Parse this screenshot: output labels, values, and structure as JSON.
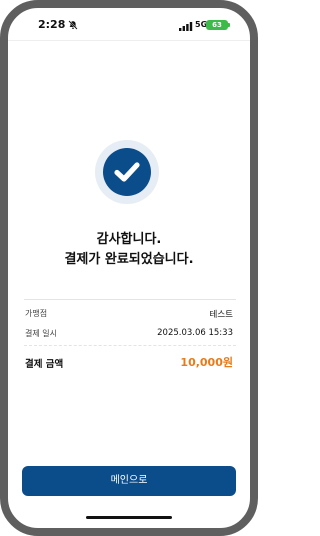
{
  "status_bar": {
    "time": "2:28",
    "network": "5G",
    "battery": "63"
  },
  "icons": {
    "mute": "bell-slash-icon",
    "signal": "signal-icon",
    "success": "check-circle-icon"
  },
  "colors": {
    "primary": "#0b4c8b",
    "accent": "#e87a17",
    "success_halo": "#e6edf4"
  },
  "message": {
    "line1": "감사합니다.",
    "line2": "결제가 완료되었습니다."
  },
  "details": {
    "rows": [
      {
        "label": "가맹점",
        "value": "테스트"
      },
      {
        "label": "결제 일시",
        "value": "2025.03.06 15:33"
      }
    ],
    "total_label": "결제 금액",
    "total_value": "10,000원"
  },
  "main_button_label": "메인으로"
}
